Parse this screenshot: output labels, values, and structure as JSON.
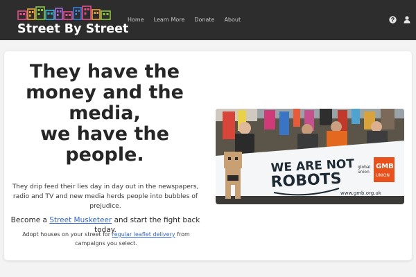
{
  "brand": {
    "name": "Street By Street"
  },
  "nav": {
    "links": [
      "Home",
      "Learn More",
      "Donate",
      "About"
    ],
    "icons": [
      "help-icon",
      "user-icon"
    ]
  },
  "hero": {
    "headline_lines": [
      "They have the",
      "money and the",
      "media,",
      "we have the",
      "people."
    ],
    "description": "They drip feed their lies day in day out in the newspapers, radio and TV and new media herds people into bubbles of prejudice.",
    "cta_before": "Become a ",
    "cta_link": "Street Musketeer",
    "cta_after": " and start the fight back today.",
    "sub_before": "Adopt houses on your street for ",
    "sub_link": "regular leaflet delivery",
    "sub_after": " from campaigns you select.",
    "photo": {
      "banner_text_line1": "WE ARE NOT",
      "banner_text_line2": "ROBOTS",
      "union_text": "GMB",
      "union_sub": "UNION",
      "gu_line1": "global",
      "gu_line2": "union",
      "url_text": "www.gmb.org.uk"
    }
  },
  "colors": {
    "navbar": "#2d2d2d",
    "link": "#3366cc",
    "gmb_orange": "#e8501c"
  }
}
